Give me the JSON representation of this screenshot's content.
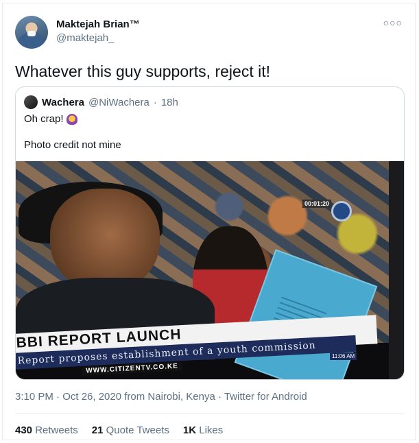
{
  "tweet": {
    "author_name": "Maktejah Brian™",
    "author_handle": "@maktejah_",
    "more_icon": "more-dots-icon",
    "text": "Whatever this guy supports, reject it!",
    "timestamp": "3:10 PM · Oct 26, 2020 from Nairobi, Kenya · Twitter for Android"
  },
  "quote": {
    "name": "Wachera",
    "handle": "@NiWachera",
    "separator": "·",
    "time": "18h",
    "line1": "Oh crap!",
    "line1_icon": "woman-facepalming-icon",
    "line2": "Photo credit not mine"
  },
  "photo": {
    "banner_title": "BBI REPORT LAUNCH",
    "banner_sub": "Report proposes establishment of a youth commission",
    "banner_url": "WWW.CITIZENTV.CO.KE",
    "live_time": "00:01:20",
    "clock": "11:06 AM"
  },
  "stats": {
    "retweets_count": "430",
    "retweets_label": "Retweets",
    "quotes_count": "21",
    "quotes_label": "Quote Tweets",
    "likes_count": "1K",
    "likes_label": "Likes"
  },
  "colors": {
    "text_primary": "#0f1419",
    "text_secondary": "#5b7083",
    "border": "#e6ecf0",
    "banner_navy": "#1d2c5a"
  }
}
